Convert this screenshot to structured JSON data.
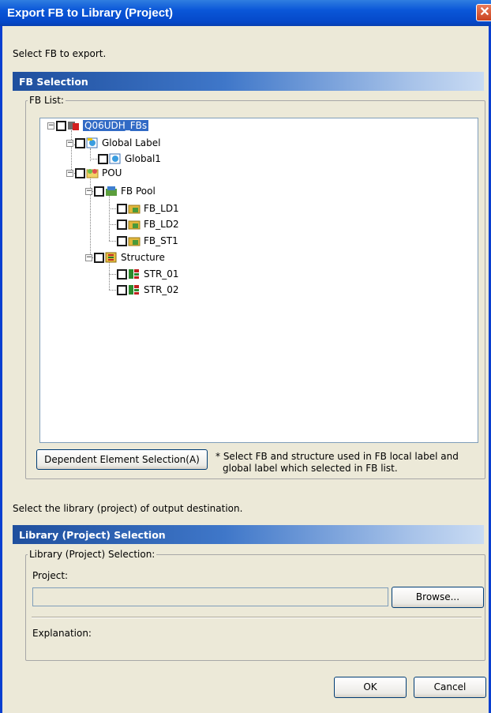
{
  "window": {
    "title": "Export FB to Library (Project)"
  },
  "prompt_fb": "Select FB to export.",
  "fb_section": {
    "header": "FB Selection",
    "group_label": "FB List:",
    "tree": [
      {
        "label": "Q06UDH_FBs",
        "icon": "project-icon",
        "selected": true
      },
      {
        "label": "Global Label",
        "icon": "global-label-icon"
      },
      {
        "label": "Global1",
        "icon": "global-label-icon"
      },
      {
        "label": "POU",
        "icon": "pou-folder-icon"
      },
      {
        "label": "FB Pool",
        "icon": "fb-pool-icon"
      },
      {
        "label": "FB_LD1",
        "icon": "fb-icon"
      },
      {
        "label": "FB_LD2",
        "icon": "fb-icon"
      },
      {
        "label": "FB_ST1",
        "icon": "fb-icon"
      },
      {
        "label": "Structure",
        "icon": "structure-icon"
      },
      {
        "label": "STR_01",
        "icon": "struct-item-icon"
      },
      {
        "label": "STR_02",
        "icon": "struct-item-icon"
      }
    ],
    "dependent_button": "Dependent Element Selection(A)",
    "note_line1": "* Select FB and structure used in FB local label and",
    "note_line2": "global label which selected in FB list."
  },
  "prompt_lib": "Select the library (project) of output destination.",
  "lib_section": {
    "header": "Library (Project) Selection",
    "group_label": "Library (Project) Selection:",
    "project_label": "Project:",
    "project_value": "",
    "browse_button": "Browse...",
    "explanation_label": "Explanation:"
  },
  "buttons": {
    "ok": "OK",
    "cancel": "Cancel"
  }
}
